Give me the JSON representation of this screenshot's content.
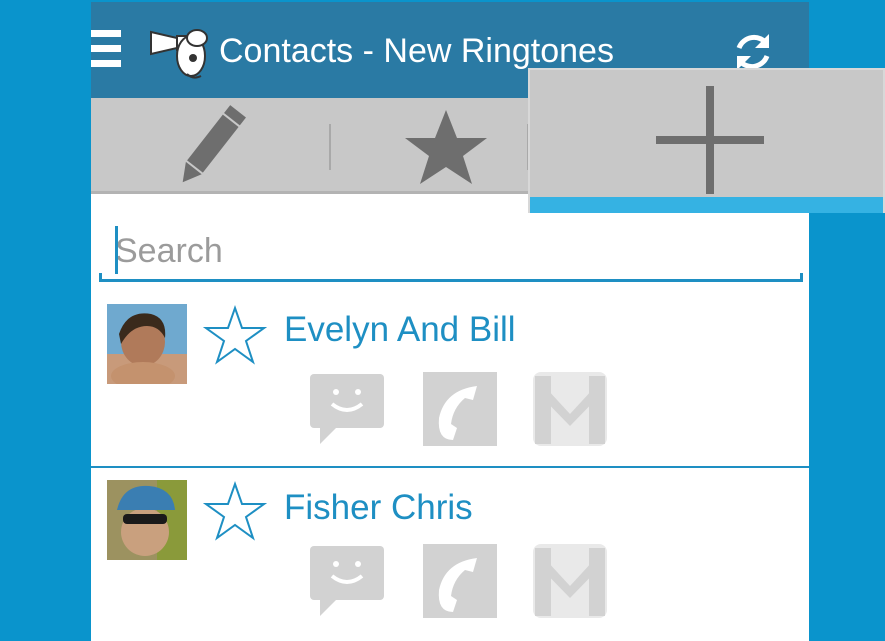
{
  "actionbar": {
    "title": "Contacts - New Ringtones",
    "menu_icon": "hamburger-menu-icon",
    "logo_icon": "megaphone-mascot-logo",
    "refresh_icon": "refresh-sync-icon",
    "background": "#2a7aa4"
  },
  "toolbar": {
    "edit_icon": "pencil-icon",
    "favorites_icon": "star-icon",
    "add_icon": "plus-icon",
    "add_selected_indicator": "#35b2e3"
  },
  "search": {
    "placeholder": "Search",
    "value": ""
  },
  "contacts": [
    {
      "name": "Evelyn And Bill",
      "favorite": false,
      "actions": [
        "sms-icon",
        "phone-icon",
        "gmail-icon"
      ]
    },
    {
      "name": "Fisher Chris",
      "favorite": false,
      "actions": [
        "sms-icon",
        "phone-icon",
        "gmail-icon"
      ]
    }
  ],
  "colors": {
    "accent": "#1e8fc3",
    "background": "#0a94cc",
    "toolbar": "#c8c8c8"
  }
}
